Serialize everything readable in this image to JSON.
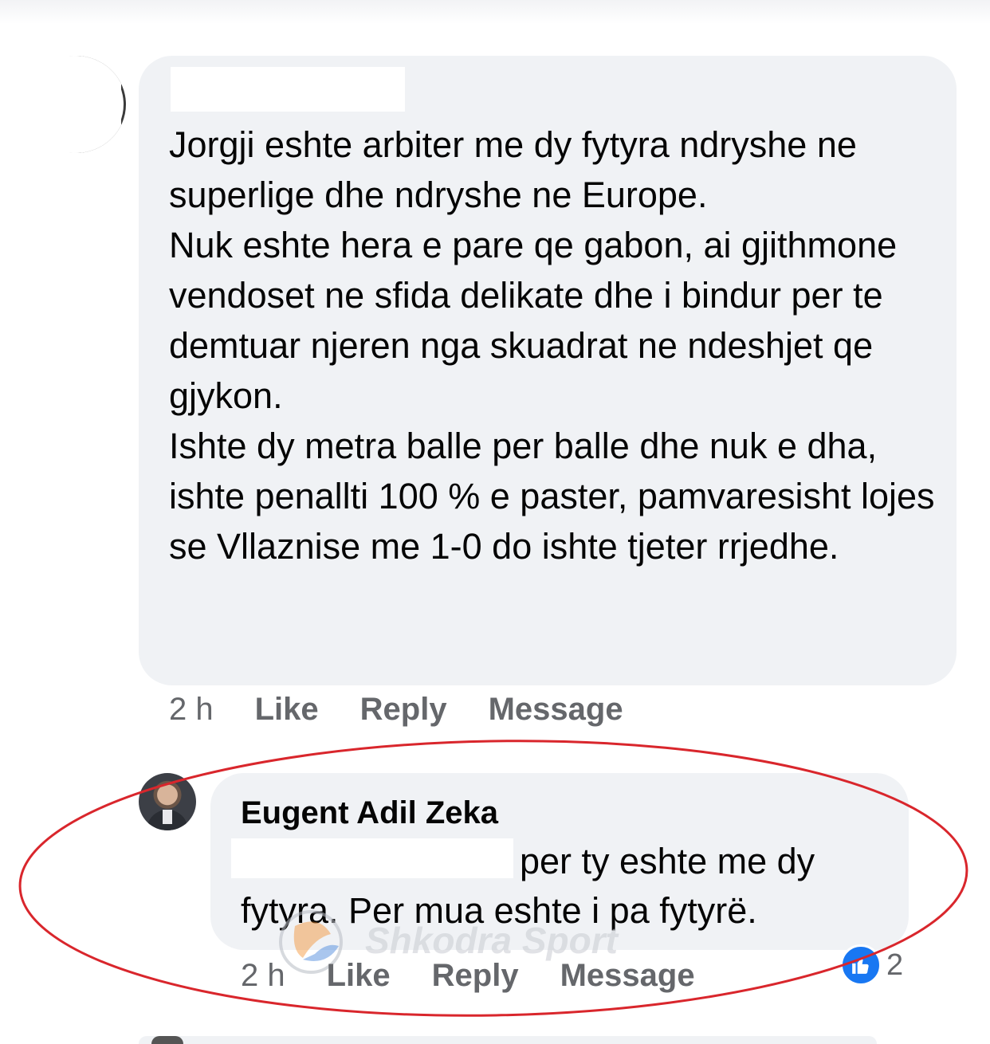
{
  "comments": [
    {
      "author": "",
      "text": "Jorgji eshte arbiter me dy fytyra ndryshe ne superlige dhe ndryshe ne Europe.\nNuk eshte hera e pare qe gabon, ai gjithmone vendoset ne sfida delikate dhe i bindur per te demtuar njeren nga skuadrat ne ndeshjet qe gjykon.\nIshte dy metra balle per balle dhe nuk e dha, ishte  penallti 100 % e paster, pamvaresisht lojes se Vllaznise me 1-0 do ishte tjeter rrjedhe.",
      "time": "2 h",
      "like_label": "Like",
      "reply_label": "Reply",
      "message_label": "Message"
    },
    {
      "author": "Eugent Adil Zeka",
      "text": "per ty eshte me dy fytyra. Per mua  eshte i pa fytyrë.",
      "time": "2 h",
      "like_label": "Like",
      "reply_label": "Reply",
      "message_label": "Message",
      "reaction_count": "2"
    }
  ],
  "watermark": "Shkodra Sport",
  "colors": {
    "bubble": "#f0f2f5",
    "meta_text": "#65676b",
    "like_blue": "#1877f2",
    "highlight_ellipse": "#d9262c"
  }
}
